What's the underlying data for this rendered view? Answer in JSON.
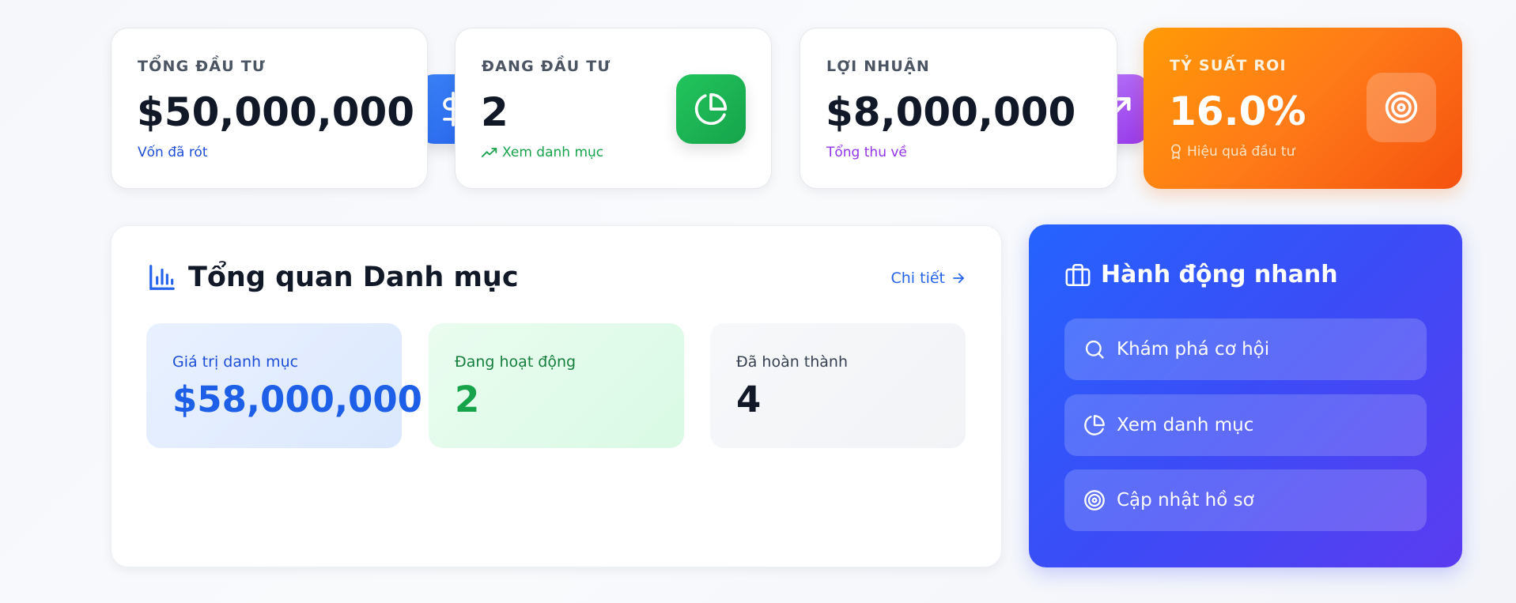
{
  "stats": [
    {
      "label": "TỔNG ĐẦU TƯ",
      "value": "$50,000,000",
      "sub": "Vốn đã rót",
      "icon": "dollar-icon",
      "accent": "#2563eb",
      "sub_color": "#1d4ed8"
    },
    {
      "label": "ĐANG ĐẦU TƯ",
      "value": "2",
      "sub": "Xem danh mục",
      "icon": "pie-chart-icon",
      "accent": "#16a34a",
      "sub_color": "#16a34a"
    },
    {
      "label": "LỢI NHUẬN",
      "value": "$8,000,000",
      "sub": "Tổng thu về",
      "icon": "trending-up-icon",
      "accent": "#a855f7",
      "sub_color": "#9333ea"
    },
    {
      "label": "TỶ SUẤT ROI",
      "value": "16.0%",
      "sub": "Hiệu quả đầu tư",
      "icon": "target-icon",
      "accent": "#f97316",
      "sub_color": "#fde3c4"
    }
  ],
  "portfolio": {
    "title": "Tổng quan Danh mục",
    "detail_label": "Chi tiết",
    "metrics": [
      {
        "label": "Giá trị danh mục",
        "value": "$58,000,000"
      },
      {
        "label": "Đang hoạt động",
        "value": "2"
      },
      {
        "label": "Đã hoàn thành",
        "value": "4"
      }
    ]
  },
  "quick_actions": {
    "title": "Hành động nhanh",
    "items": [
      {
        "label": "Khám phá cơ hội",
        "icon": "search-icon"
      },
      {
        "label": "Xem danh mục",
        "icon": "pie-chart-icon"
      },
      {
        "label": "Cập nhật hồ sơ",
        "icon": "target-icon"
      }
    ]
  }
}
